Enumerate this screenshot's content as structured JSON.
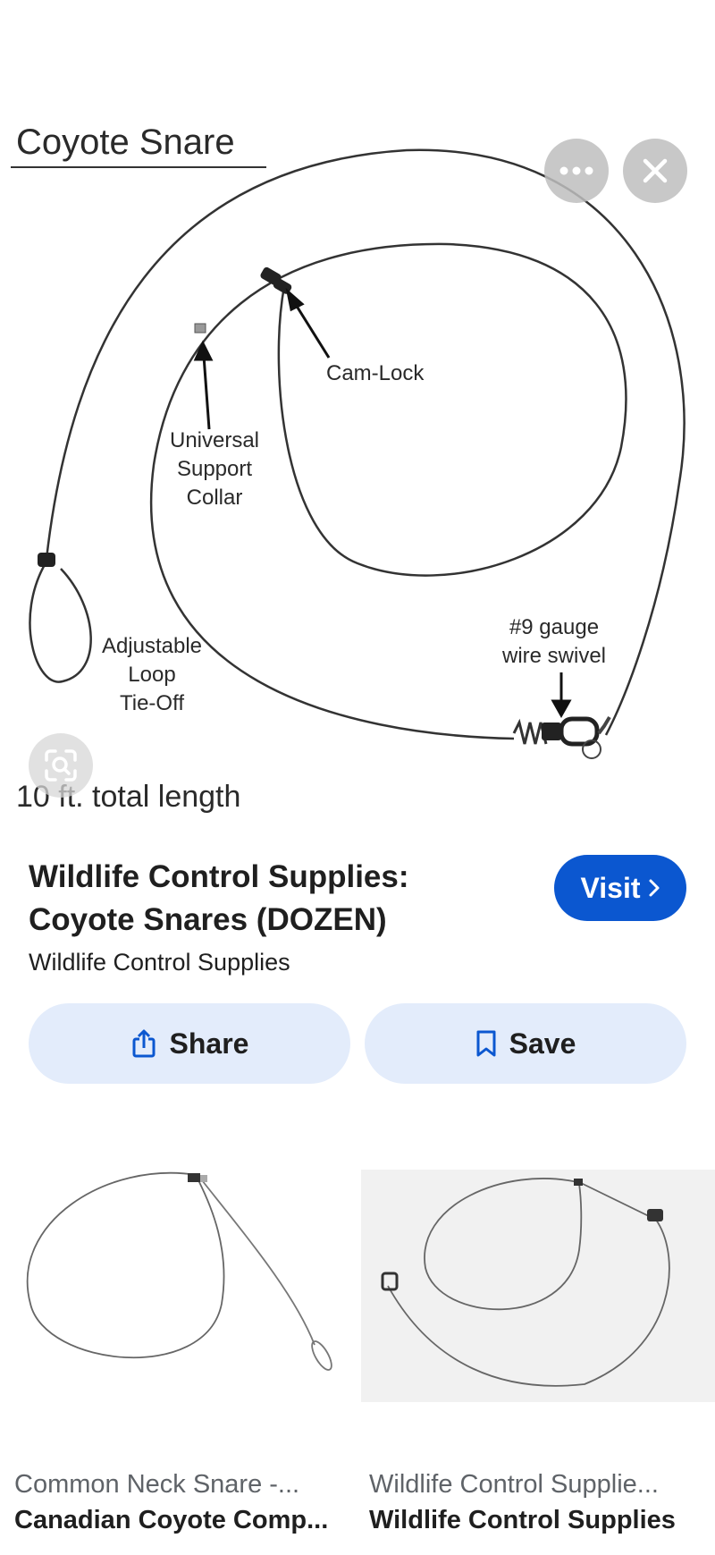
{
  "hero": {
    "diagram": {
      "title": "Coyote Snare",
      "cam_lock_label": "Cam-Lock",
      "collar_label_lines": [
        "Universal",
        "Support",
        "Collar"
      ],
      "loop_label_lines": [
        "Adjustable",
        "Loop",
        "Tie-Off"
      ],
      "swivel_label_lines": [
        "#9 gauge",
        "wire swivel"
      ],
      "length_label": "10 ft. total length"
    },
    "icons": {
      "more": "more-horizontal-icon",
      "close": "close-icon",
      "lens": "lens-icon"
    }
  },
  "item": {
    "title_line1": "Wildlife Control Supplies:",
    "title_line2": "Coyote Snares (DOZEN)",
    "source": "Wildlife Control Supplies",
    "visit_label": "Visit",
    "share_label": "Share",
    "save_label": "Save"
  },
  "related": [
    {
      "site": "Common Neck Snare -...",
      "title": "Canadian Coyote Comp..."
    },
    {
      "site": "Wildlife Control Supplie...",
      "title": "Wildlife Control Supplies"
    }
  ],
  "colors": {
    "visit_button": "#0b57d0",
    "action_button": "#e3ecfb"
  }
}
